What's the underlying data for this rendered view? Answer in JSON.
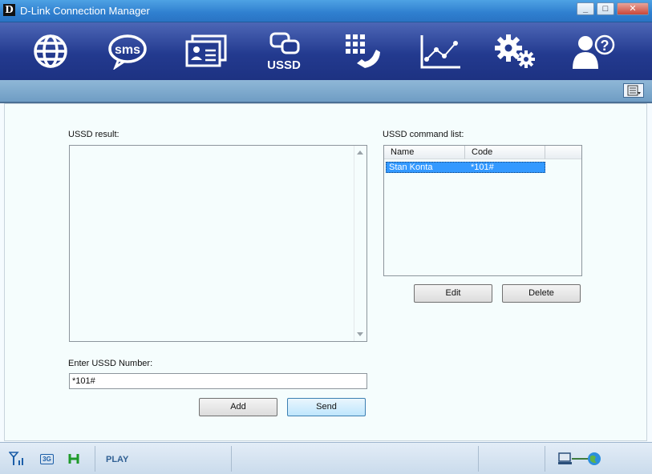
{
  "app": {
    "logo_letter": "D",
    "title": "D-Link Connection Manager"
  },
  "window_controls": {
    "minimize": "_",
    "maximize": "□",
    "close": "✕"
  },
  "toolbar": [
    {
      "name": "internet-button",
      "icon": "globe-icon"
    },
    {
      "name": "sms-button",
      "icon": "sms-icon",
      "text": "sms"
    },
    {
      "name": "phonebook-button",
      "icon": "contact-card-icon"
    },
    {
      "name": "ussd-button",
      "icon": "ussd-chat-icon",
      "text": "USSD"
    },
    {
      "name": "dialer-button",
      "icon": "phone-keypad-icon"
    },
    {
      "name": "statistics-button",
      "icon": "line-chart-icon"
    },
    {
      "name": "settings-button",
      "icon": "gears-icon"
    },
    {
      "name": "help-button",
      "icon": "user-help-icon",
      "text": "?"
    }
  ],
  "ussd": {
    "result_label": "USSD result:",
    "result_text": "",
    "command_list_label": "USSD command list:",
    "columns": [
      "Name",
      "Code"
    ],
    "rows": [
      {
        "name": "Stan Konta",
        "code": "*101#"
      }
    ],
    "edit_label": "Edit",
    "delete_label": "Delete",
    "number_label": "Enter USSD Number:",
    "number_value": "*101#",
    "add_label": "Add",
    "send_label": "Send"
  },
  "status": {
    "network_type": "3G",
    "operator": "PLAY"
  },
  "colors": {
    "titlebar": "#2f7fcf",
    "toolbar": "#233a8f",
    "selection": "#3399ff",
    "status_text": "#2f5f93"
  }
}
